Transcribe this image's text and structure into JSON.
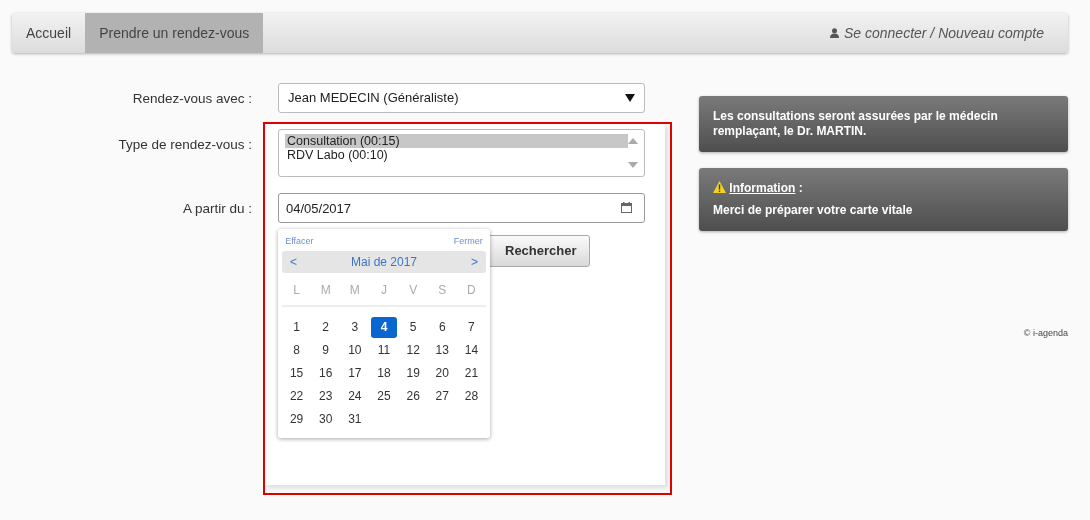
{
  "navbar": {
    "tabs": [
      {
        "label": "Accueil",
        "selected": false
      },
      {
        "label": "Prendre un rendez-vous",
        "selected": true
      }
    ],
    "account_link": "Se connecter / Nouveau compte"
  },
  "form": {
    "doctor": {
      "label": "Rendez-vous avec :",
      "value": "Jean MEDECIN (Généraliste)"
    },
    "type": {
      "label": "Type de rendez-vous :",
      "options": [
        {
          "label": "Consultation (00:15)",
          "selected": true
        },
        {
          "label": "RDV Labo (00:10)",
          "selected": false
        }
      ]
    },
    "date": {
      "label": "A partir du :",
      "value": "04/05/2017"
    },
    "search_button": "Rechercher"
  },
  "datepicker": {
    "clear": "Effacer",
    "close": "Fermer",
    "prev": "<",
    "month": "Mai",
    "of": "de",
    "year": "2017",
    "next": ">",
    "weekdays": [
      "L",
      "M",
      "M",
      "J",
      "V",
      "S",
      "D"
    ],
    "days": [
      {
        "label": "1",
        "selected": false
      },
      {
        "label": "2",
        "selected": false
      },
      {
        "label": "3",
        "selected": false
      },
      {
        "label": "4",
        "selected": true
      },
      {
        "label": "5",
        "selected": false
      },
      {
        "label": "6",
        "selected": false
      },
      {
        "label": "7",
        "selected": false
      },
      {
        "label": "8",
        "selected": false
      },
      {
        "label": "9",
        "selected": false
      },
      {
        "label": "10",
        "selected": false
      },
      {
        "label": "11",
        "selected": false
      },
      {
        "label": "12",
        "selected": false
      },
      {
        "label": "13",
        "selected": false
      },
      {
        "label": "14",
        "selected": false
      },
      {
        "label": "15",
        "selected": false
      },
      {
        "label": "16",
        "selected": false
      },
      {
        "label": "17",
        "selected": false
      },
      {
        "label": "18",
        "selected": false
      },
      {
        "label": "19",
        "selected": false
      },
      {
        "label": "20",
        "selected": false
      },
      {
        "label": "21",
        "selected": false
      },
      {
        "label": "22",
        "selected": false
      },
      {
        "label": "23",
        "selected": false
      },
      {
        "label": "24",
        "selected": false
      },
      {
        "label": "25",
        "selected": false
      },
      {
        "label": "26",
        "selected": false
      },
      {
        "label": "27",
        "selected": false
      },
      {
        "label": "28",
        "selected": false
      },
      {
        "label": "29",
        "selected": false
      },
      {
        "label": "30",
        "selected": false
      },
      {
        "label": "31",
        "selected": false
      }
    ]
  },
  "notices": [
    {
      "text": "Les consultations seront assurées par le médecin remplaçant, le Dr. MARTIN."
    },
    {
      "title": "Information",
      "title_suffix": " :",
      "text": "Merci de préparer votre carte vitale"
    }
  ],
  "footer": "© i-agenda"
}
